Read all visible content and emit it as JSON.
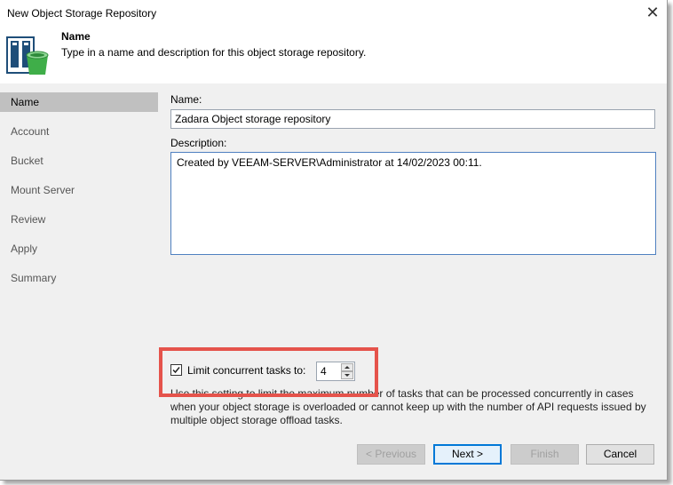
{
  "window": {
    "title": "New Object Storage Repository",
    "close_glyph": "✕"
  },
  "header": {
    "icon": "object-storage-bucket-icon",
    "title": "Name",
    "subtitle": "Type in a name and description for this object storage repository."
  },
  "sidebar": {
    "items": [
      {
        "label": "Name",
        "active": true
      },
      {
        "label": "Account",
        "active": false
      },
      {
        "label": "Bucket",
        "active": false
      },
      {
        "label": "Mount Server",
        "active": false
      },
      {
        "label": "Review",
        "active": false
      },
      {
        "label": "Apply",
        "active": false
      },
      {
        "label": "Summary",
        "active": false
      }
    ]
  },
  "form": {
    "name_label": "Name:",
    "name_value": "Zadara Object storage repository",
    "description_label": "Description:",
    "description_value": "Created by VEEAM-SERVER\\Administrator at 14/02/2023 00:11.",
    "limit_checked": true,
    "limit_label": "Limit concurrent tasks to:",
    "limit_value": "4",
    "hint": "Use this setting to limit the maximum number of tasks that can be processed concurrently in cases when your object storage is overloaded or cannot keep up with the number of API requests issued by multiple object storage offload tasks."
  },
  "footer": {
    "previous_label": "< Previous",
    "next_label": "Next >",
    "finish_label": "Finish",
    "cancel_label": "Cancel"
  },
  "colors": {
    "highlight": "#e5534b",
    "active_nav": "#c0c0c0",
    "panel": "#f0f0f0",
    "focus_border": "#0078d7"
  }
}
